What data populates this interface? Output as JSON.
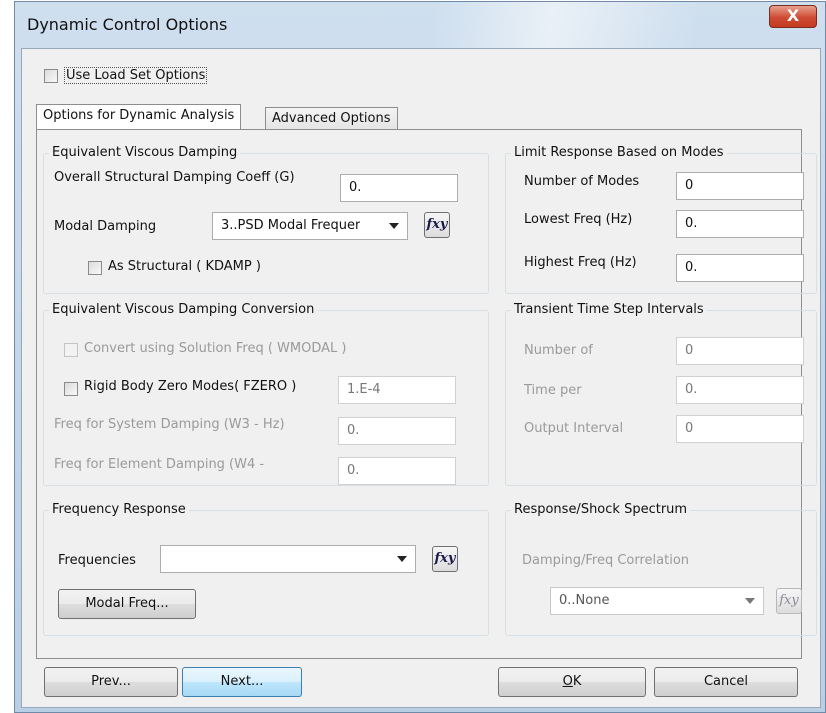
{
  "window": {
    "title": "Dynamic Control Options",
    "close_glyph": "X"
  },
  "use_load_set": {
    "label": "Use Load Set Options",
    "checked": false
  },
  "tabs": [
    {
      "label": "Options for Dynamic Analysis",
      "active": true
    },
    {
      "label": "Advanced Options",
      "active": false
    }
  ],
  "viscous_damping": {
    "title": "Equivalent Viscous Damping",
    "overall_label": "Overall Structural Damping Coeff (G)",
    "overall_value": "0.",
    "modal_label": "Modal Damping",
    "modal_value": "3..PSD Modal Frequer",
    "fxy_label": "fxy",
    "as_structural_label": "As Structural ( KDAMP )"
  },
  "limit_response": {
    "title": "Limit Response Based on Modes",
    "num_modes_label": "Number of Modes",
    "num_modes_value": "0",
    "lowest_label": "Lowest Freq (Hz)",
    "lowest_value": "0.",
    "highest_label": "Highest Freq (Hz)",
    "highest_value": "0."
  },
  "damping_conversion": {
    "title": "Equivalent Viscous Damping Conversion",
    "convert_label": "Convert using Solution Freq ( WMODAL )",
    "rigid_label": "Rigid Body Zero Modes( FZERO )",
    "rigid_value": "1.E-4",
    "w3_label": "Freq for System Damping (W3 - Hz)",
    "w3_value": "0.",
    "w4_label": "Freq for Element Damping (W4 -",
    "w4_value": "0."
  },
  "transient": {
    "title": "Transient Time Step Intervals",
    "number_label": "Number of",
    "number_value": "0",
    "time_label": "Time per",
    "time_value": "0.",
    "output_label": "Output Interval",
    "output_value": "0"
  },
  "frequency_response": {
    "title": "Frequency Response",
    "freq_label": "Frequencies",
    "freq_value": "",
    "fxy_label": "fxy",
    "modal_freq_button": "Modal Freq..."
  },
  "shock_spectrum": {
    "title": "Response/Shock Spectrum",
    "damping_label": "Damping/Freq Correlation",
    "damping_value": "0..None",
    "fxy_label": "fxy"
  },
  "buttons": {
    "prev": "Prev...",
    "next": "Next...",
    "ok": "OK",
    "cancel": "Cancel"
  }
}
